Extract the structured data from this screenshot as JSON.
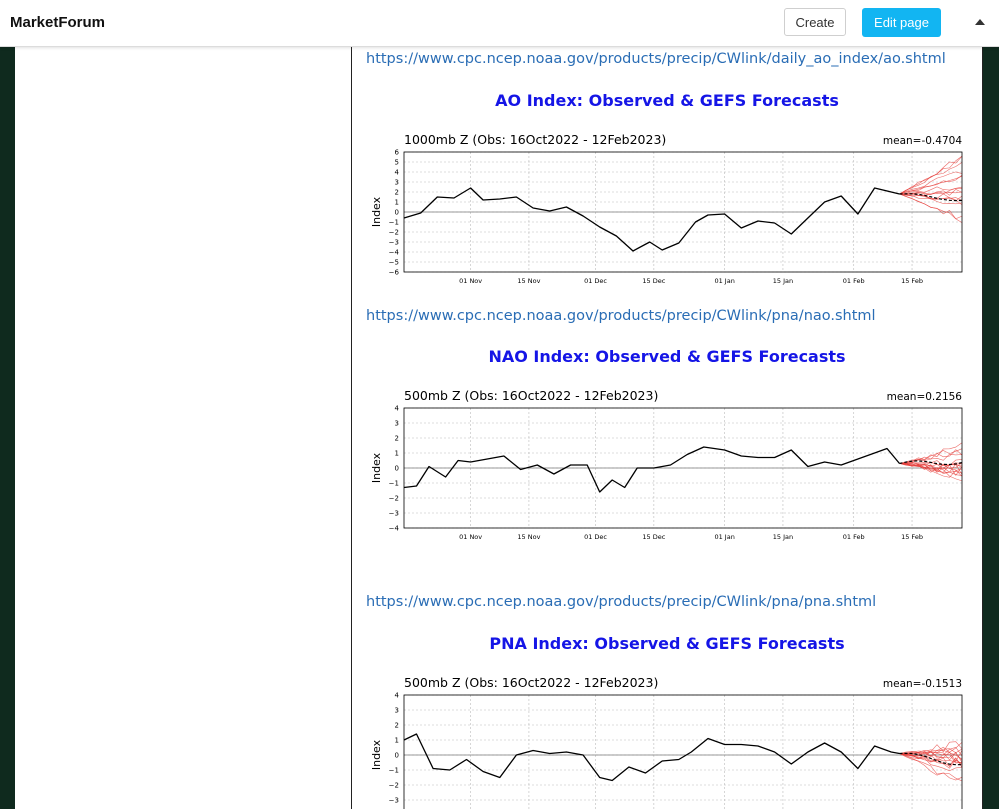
{
  "header": {
    "brand": "MarketForum",
    "create_label": "Create",
    "edit_label": "Edit page",
    "collapse_icon": "caret-up-icon"
  },
  "colors": {
    "accent": "#12b5f2",
    "link": "#2a6db5",
    "figure_title": "#1515e6",
    "ensemble": "#e53935"
  },
  "post": {
    "links": [
      "https://www.cpc.ncep.noaa.gov/products/precip/CWlink/daily_ao_index/ao.shtml",
      "https://www.cpc.ncep.noaa.gov/products/precip/CWlink/pna/nao.shtml",
      "https://www.cpc.ncep.noaa.gov/products/precip/CWlink/pna/pna.shtml"
    ],
    "figures": [
      {
        "title": "AO Index: Observed & GEFS Forecasts"
      },
      {
        "title": "NAO Index: Observed & GEFS Forecasts"
      },
      {
        "title": "PNA Index: Observed & GEFS Forecasts"
      }
    ]
  },
  "chart_data": [
    {
      "type": "line",
      "title": "1000mb Z (Obs: 16Oct2022 - 12Feb2023)",
      "annotation": "mean=-0.4704",
      "ylabel": "Index",
      "ylim": [
        -6,
        6
      ],
      "yticks": [
        "6",
        "5",
        "4",
        "3",
        "2",
        "1",
        "0",
        "−1",
        "−2",
        "−3",
        "−4",
        "−5",
        "−6"
      ],
      "xticks": [
        "01 Nov",
        "15 Nov",
        "01 Dec",
        "15 Dec",
        "01 Jan",
        "15 Jan",
        "01 Feb",
        "15 Feb"
      ],
      "xlim": [
        "2022-10-16",
        "2023-02-27"
      ],
      "grid": true,
      "series": [
        {
          "x": [
            "2022-10-16",
            "2022-10-20",
            "2022-10-24",
            "2022-10-28",
            "2022-11-01",
            "2022-11-04",
            "2022-11-08",
            "2022-11-12",
            "2022-11-16",
            "2022-11-20",
            "2022-11-24",
            "2022-11-28",
            "2022-12-02",
            "2022-12-06",
            "2022-12-10",
            "2022-12-14",
            "2022-12-17",
            "2022-12-21",
            "2022-12-25",
            "2022-12-28",
            "2023-01-01",
            "2023-01-05",
            "2023-01-09",
            "2023-01-13",
            "2023-01-17",
            "2023-01-21",
            "2023-01-25",
            "2023-01-29",
            "2023-02-02",
            "2023-02-06",
            "2023-02-10",
            "2023-02-12"
          ],
          "y": [
            -0.6,
            -0.1,
            1.5,
            1.4,
            2.4,
            1.2,
            1.3,
            1.5,
            0.4,
            0.1,
            0.5,
            -0.4,
            -1.5,
            -2.4,
            -3.9,
            -3.0,
            -3.8,
            -3.1,
            -1.0,
            -0.3,
            -0.2,
            -1.6,
            -0.9,
            -1.1,
            -2.2,
            -0.6,
            1.0,
            1.6,
            -0.2,
            2.4,
            2.0,
            1.8
          ]
        }
      ],
      "forecast": {
        "start": "2023-02-12",
        "end": "2023-02-27",
        "mean_end": 1.2,
        "spread": [
          -1.5,
          5.5
        ]
      }
    },
    {
      "type": "line",
      "title": "500mb Z (Obs: 16Oct2022 - 12Feb2023)",
      "annotation": "mean=0.2156",
      "ylabel": "Index",
      "ylim": [
        -4,
        4
      ],
      "yticks": [
        "4",
        "3",
        "2",
        "1",
        "0",
        "−1",
        "−2",
        "−3",
        "−4"
      ],
      "xticks": [
        "01 Nov",
        "15 Nov",
        "01 Dec",
        "15 Dec",
        "01 Jan",
        "15 Jan",
        "01 Feb",
        "15 Feb"
      ],
      "xlim": [
        "2022-10-16",
        "2023-02-27"
      ],
      "grid": true,
      "series": [
        {
          "x": [
            "2022-10-16",
            "2022-10-19",
            "2022-10-22",
            "2022-10-26",
            "2022-10-29",
            "2022-11-01",
            "2022-11-05",
            "2022-11-09",
            "2022-11-13",
            "2022-11-17",
            "2022-11-21",
            "2022-11-25",
            "2022-11-29",
            "2022-12-02",
            "2022-12-05",
            "2022-12-08",
            "2022-12-11",
            "2022-12-15",
            "2022-12-19",
            "2022-12-23",
            "2022-12-27",
            "2023-01-01",
            "2023-01-05",
            "2023-01-09",
            "2023-01-13",
            "2023-01-17",
            "2023-01-21",
            "2023-01-25",
            "2023-01-29",
            "2023-02-02",
            "2023-02-06",
            "2023-02-09",
            "2023-02-12"
          ],
          "y": [
            -1.3,
            -1.2,
            0.1,
            -0.6,
            0.5,
            0.4,
            0.6,
            0.8,
            -0.1,
            0.2,
            -0.4,
            0.2,
            0.2,
            -1.6,
            -0.8,
            -1.3,
            0.0,
            0.0,
            0.2,
            0.9,
            1.4,
            1.2,
            0.8,
            0.7,
            0.7,
            1.2,
            0.1,
            0.4,
            0.2,
            0.6,
            1.0,
            1.3,
            0.3
          ]
        }
      ],
      "forecast": {
        "start": "2023-02-12",
        "end": "2023-02-27",
        "mean_end": 0.4,
        "spread": [
          -0.6,
          1.4
        ]
      }
    },
    {
      "type": "line",
      "title": "500mb Z (Obs: 16Oct2022 - 12Feb2023)",
      "annotation": "mean=-0.1513",
      "ylabel": "Index",
      "ylim": [
        -4,
        4
      ],
      "yticks": [
        "4",
        "3",
        "2",
        "1",
        "0",
        "−1",
        "−2",
        "−3"
      ],
      "xticks": [],
      "xlim": [
        "2022-10-16",
        "2023-02-27"
      ],
      "grid": true,
      "series": [
        {
          "x": [
            "2022-10-16",
            "2022-10-19",
            "2022-10-23",
            "2022-10-27",
            "2022-10-31",
            "2022-11-04",
            "2022-11-08",
            "2022-11-12",
            "2022-11-16",
            "2022-11-20",
            "2022-11-24",
            "2022-11-28",
            "2022-12-02",
            "2022-12-05",
            "2022-12-09",
            "2022-12-13",
            "2022-12-17",
            "2022-12-21",
            "2022-12-24",
            "2022-12-28",
            "2023-01-01",
            "2023-01-05",
            "2023-01-09",
            "2023-01-13",
            "2023-01-17",
            "2023-01-21",
            "2023-01-25",
            "2023-01-29",
            "2023-02-02",
            "2023-02-06",
            "2023-02-10",
            "2023-02-12"
          ],
          "y": [
            1.0,
            1.4,
            -0.9,
            -1.0,
            -0.3,
            -1.1,
            -1.5,
            0.0,
            0.3,
            0.1,
            0.2,
            0.0,
            -1.5,
            -1.7,
            -0.8,
            -1.2,
            -0.4,
            -0.3,
            0.2,
            1.1,
            0.7,
            0.7,
            0.6,
            0.2,
            -0.6,
            0.2,
            0.8,
            0.2,
            -0.9,
            0.6,
            0.2,
            0.1
          ]
        }
      ],
      "forecast": {
        "start": "2023-02-12",
        "end": "2023-02-27",
        "mean_end": -0.6,
        "spread": [
          -2.0,
          0.8
        ]
      }
    }
  ]
}
